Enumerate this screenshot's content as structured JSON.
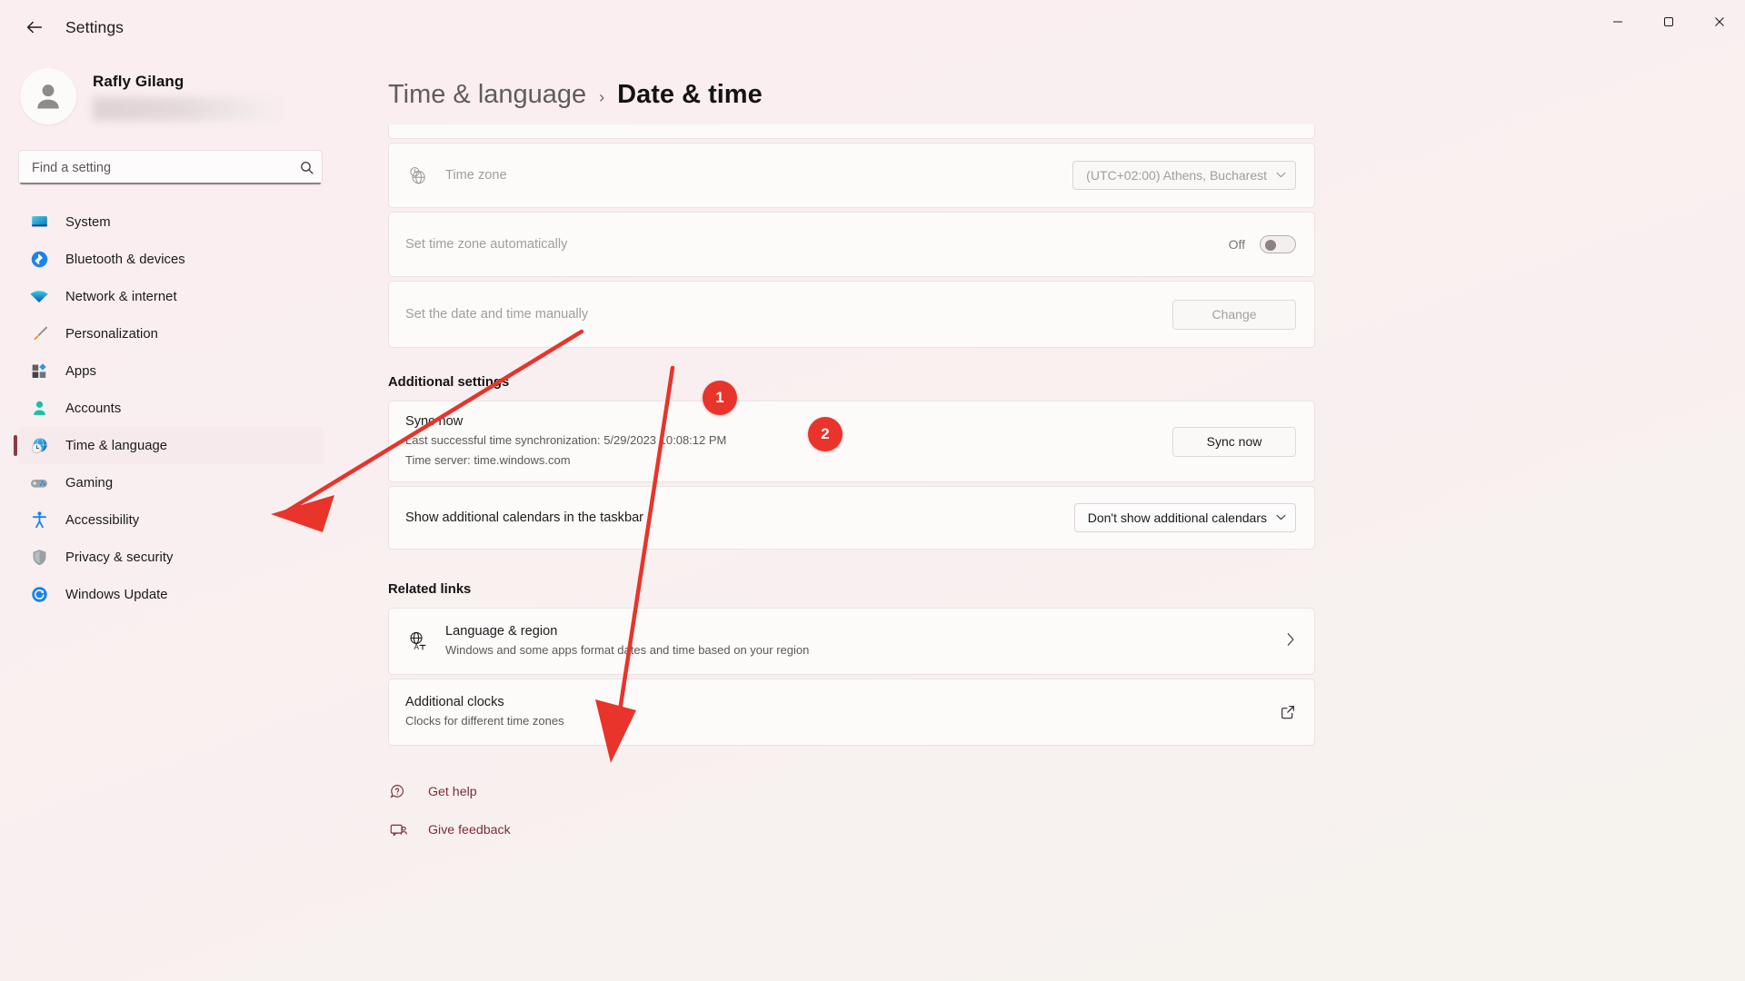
{
  "window": {
    "title": "Settings",
    "back_icon": "back-arrow-icon",
    "minimize": "–",
    "maximize": "☐",
    "close": "✕"
  },
  "profile": {
    "name": "Rafly Gilang",
    "email_redacted": ""
  },
  "search": {
    "placeholder": "Find a setting",
    "value": "",
    "icon": "search-icon"
  },
  "sidebar": {
    "items": [
      {
        "label": "System",
        "icon": "monitor-icon",
        "selected": false
      },
      {
        "label": "Bluetooth & devices",
        "icon": "bluetooth-icon",
        "selected": false
      },
      {
        "label": "Network & internet",
        "icon": "wifi-icon",
        "selected": false
      },
      {
        "label": "Personalization",
        "icon": "paintbrush-icon",
        "selected": false
      },
      {
        "label": "Apps",
        "icon": "apps-grid-icon",
        "selected": false
      },
      {
        "label": "Accounts",
        "icon": "person-icon",
        "selected": false
      },
      {
        "label": "Time & language",
        "icon": "clock-globe-icon",
        "selected": true
      },
      {
        "label": "Gaming",
        "icon": "gamepad-icon",
        "selected": false
      },
      {
        "label": "Accessibility",
        "icon": "accessibility-icon",
        "selected": false
      },
      {
        "label": "Privacy & security",
        "icon": "shield-icon",
        "selected": false
      },
      {
        "label": "Windows Update",
        "icon": "update-refresh-icon",
        "selected": false
      }
    ]
  },
  "breadcrumb": {
    "parent": "Time & language",
    "separator": "›",
    "current": "Date & time"
  },
  "settings": {
    "time_zone": {
      "label": "Time zone",
      "icon": "clock-globe-icon",
      "value": "(UTC+02:00) Athens, Bucharest",
      "chevron": "⌄",
      "disabled": true
    },
    "set_tz_auto": {
      "label": "Set time zone automatically",
      "state_label": "Off",
      "disabled": true
    },
    "set_manual": {
      "label": "Set the date and time manually",
      "button_label": "Change",
      "disabled": true
    }
  },
  "additional_settings": {
    "heading": "Additional settings",
    "sync": {
      "title": "Sync now",
      "sub_line1": "Last successful time synchronization: 5/29/2023 10:08:12 PM",
      "sub_line2": "Time server: time.windows.com",
      "button_label": "Sync now"
    },
    "calendars": {
      "label": "Show additional calendars in the taskbar",
      "value": "Don't show additional calendars",
      "chevron": "⌄"
    }
  },
  "related_links": {
    "heading": "Related links",
    "items": [
      {
        "title": "Language & region",
        "sub": "Windows and some apps format dates and time based on your region",
        "icon": "language-globe-icon",
        "affordance": "chevron-right-icon",
        "affordance_glyph": "›"
      },
      {
        "title": "Additional clocks",
        "sub": "Clocks for different time zones",
        "icon": "none",
        "affordance": "external-link-icon",
        "affordance_glyph": ""
      }
    ]
  },
  "footer_links": [
    {
      "label": "Get help",
      "icon": "help-icon"
    },
    {
      "label": "Give feedback",
      "icon": "feedback-icon"
    }
  ],
  "annotations": {
    "color": "#e8342a",
    "markers": [
      {
        "number": "1",
        "target": "sidebar-item-time-language"
      },
      {
        "number": "2",
        "target": "related-link-additional-clocks"
      }
    ]
  }
}
